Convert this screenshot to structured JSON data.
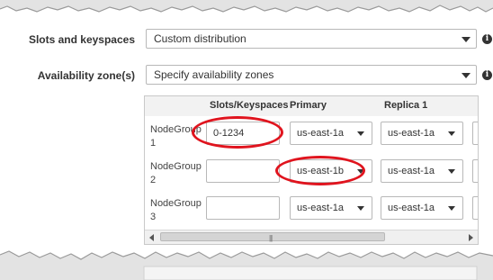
{
  "form": {
    "slots_label": "Slots and keyspaces",
    "slots_value": "Custom distribution",
    "az_label": "Availability zone(s)",
    "az_value": "Specify availability zones",
    "info_glyph": "i"
  },
  "grid": {
    "headers": [
      "Slots/Keyspaces",
      "Primary",
      "Replica 1"
    ],
    "rows": [
      {
        "label_line1": "NodeGroup",
        "label_line2": "1",
        "slots": "0-1234",
        "primary": "us-east-1a",
        "replica1": "us-east-1a"
      },
      {
        "label_line1": "NodeGroup",
        "label_line2": "2",
        "slots": "",
        "primary": "us-east-1b",
        "replica1": "us-east-1a"
      },
      {
        "label_line1": "NodeGroup",
        "label_line2": "3",
        "slots": "",
        "primary": "us-east-1a",
        "replica1": "us-east-1a"
      }
    ],
    "scroll_grip": "|||"
  },
  "colors": {
    "highlight": "#e0141e",
    "header_bg": "#f2f2f2",
    "border": "#b8b8b8"
  }
}
